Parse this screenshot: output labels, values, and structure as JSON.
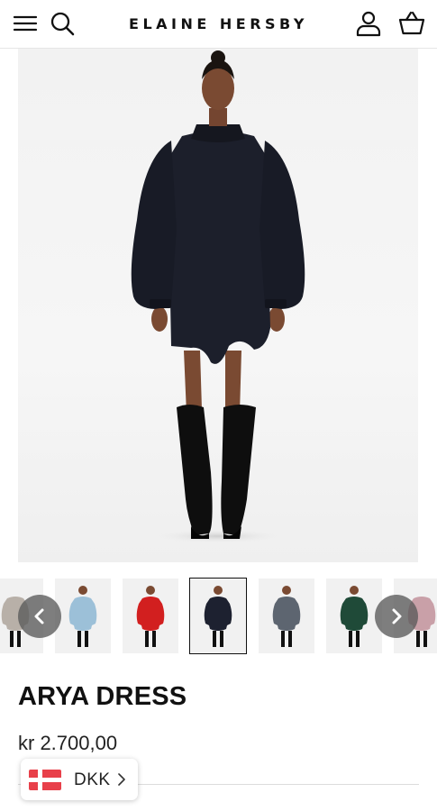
{
  "header": {
    "brand": "ELAINE HERSBY",
    "icons": [
      "menu-icon",
      "search-icon",
      "account-icon",
      "basket-icon"
    ]
  },
  "gallery": {
    "thumbnail_colors": [
      "#9cc0d8",
      "#d21f1f",
      "#1d2130",
      "#5d6570",
      "#1f4a38"
    ],
    "selected_index": 2,
    "prev_icon": "chevron-left-icon",
    "next_icon": "chevron-right-icon"
  },
  "product": {
    "name": "ARYA DRESS",
    "price": "kr 2.700,00",
    "dress_color": "#1c1f2b"
  },
  "currency_selector": {
    "code": "DKK",
    "flag": "denmark-flag-icon",
    "chevron": "chevron-right-icon"
  }
}
